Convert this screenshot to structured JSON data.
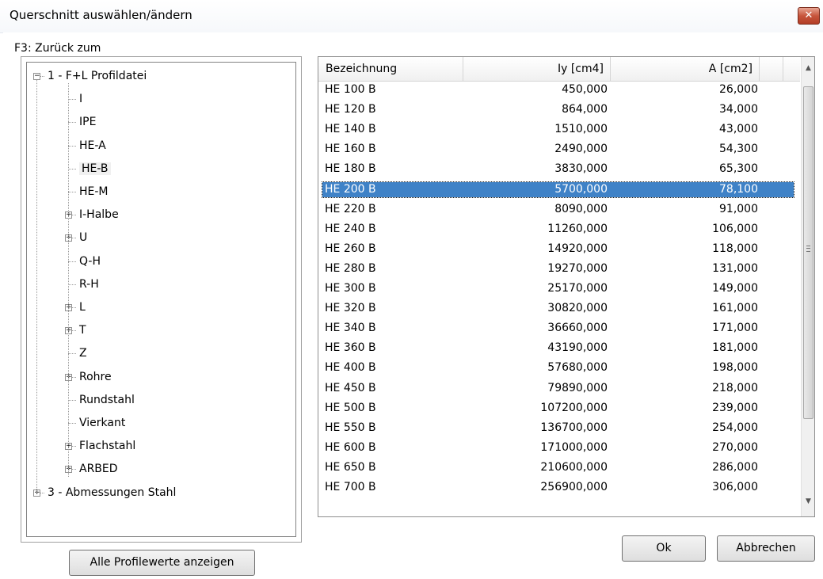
{
  "window": {
    "title": "Querschnitt auswählen/ändern",
    "close_glyph": "✕"
  },
  "tree": {
    "group_label": "F3: Zurück zum",
    "items": [
      {
        "label": "1 - F+L Profildatei",
        "expander": "minus"
      },
      {
        "label": "I",
        "expander": ""
      },
      {
        "label": "IPE",
        "expander": ""
      },
      {
        "label": "HE-A",
        "expander": ""
      },
      {
        "label": "HE-B",
        "expander": "",
        "selected": true
      },
      {
        "label": "HE-M",
        "expander": ""
      },
      {
        "label": "I-Halbe",
        "expander": "plus"
      },
      {
        "label": "U",
        "expander": "plus"
      },
      {
        "label": "Q-H",
        "expander": ""
      },
      {
        "label": "R-H",
        "expander": ""
      },
      {
        "label": "L",
        "expander": "plus"
      },
      {
        "label": "T",
        "expander": "plus"
      },
      {
        "label": "Z",
        "expander": ""
      },
      {
        "label": "Rohre",
        "expander": "plus"
      },
      {
        "label": "Rundstahl",
        "expander": ""
      },
      {
        "label": "Vierkant",
        "expander": ""
      },
      {
        "label": "Flachstahl",
        "expander": "plus"
      },
      {
        "label": "ARBED",
        "expander": "plus"
      },
      {
        "label": "3 - Abmessungen Stahl",
        "expander": "plus"
      }
    ],
    "show_all_button": "Alle Profilewerte anzeigen"
  },
  "table": {
    "columns": [
      "Bezeichnung",
      "Iy [cm4]",
      "A [cm2]"
    ],
    "rows": [
      [
        "HE  100 B",
        "450,000",
        "26,000"
      ],
      [
        "HE  120 B",
        "864,000",
        "34,000"
      ],
      [
        "HE  140 B",
        "1510,000",
        "43,000"
      ],
      [
        "HE  160 B",
        "2490,000",
        "54,300"
      ],
      [
        "HE  180 B",
        "3830,000",
        "65,300"
      ],
      [
        "HE  200 B",
        "5700,000",
        "78,100"
      ],
      [
        "HE  220 B",
        "8090,000",
        "91,000"
      ],
      [
        "HE  240 B",
        "11260,000",
        "106,000"
      ],
      [
        "HE  260 B",
        "14920,000",
        "118,000"
      ],
      [
        "HE  280 B",
        "19270,000",
        "131,000"
      ],
      [
        "HE  300 B",
        "25170,000",
        "149,000"
      ],
      [
        "HE  320 B",
        "30820,000",
        "161,000"
      ],
      [
        "HE  340 B",
        "36660,000",
        "171,000"
      ],
      [
        "HE  360 B",
        "43190,000",
        "181,000"
      ],
      [
        "HE  400 B",
        "57680,000",
        "198,000"
      ],
      [
        "HE  450 B",
        "79890,000",
        "218,000"
      ],
      [
        "HE  500 B",
        "107200,000",
        "239,000"
      ],
      [
        "HE  550 B",
        "136700,000",
        "254,000"
      ],
      [
        "HE  600 B",
        "171000,000",
        "270,000"
      ],
      [
        "HE  650 B",
        "210600,000",
        "286,000"
      ],
      [
        "HE  700 B",
        "256900,000",
        "306,000"
      ]
    ],
    "selected_row": "HE  200 B"
  },
  "buttons": {
    "ok": "Ok",
    "cancel": "Abbrechen"
  }
}
